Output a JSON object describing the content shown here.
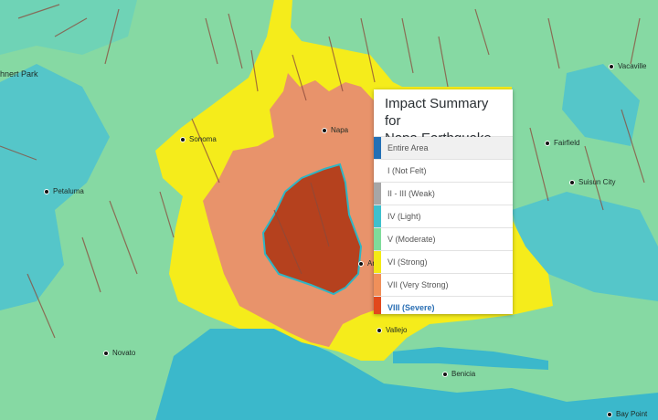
{
  "map": {
    "colors": {
      "light": "#4fc6cf",
      "moderate": "#86d9a3",
      "strong": "#f5ec1b",
      "very_strong": "#e8936b",
      "severe": "#b5411e",
      "water": "#3bb8cb",
      "fault": "#8b4a3b"
    },
    "cities": [
      {
        "name": "Vacaville"
      },
      {
        "name": "Napa"
      },
      {
        "name": "Sonoma"
      },
      {
        "name": "Fairfield"
      },
      {
        "name": "Suisun City"
      },
      {
        "name": "Petaluma"
      },
      {
        "name": "Vallejo"
      },
      {
        "name": "Novato"
      },
      {
        "name": "Benicia"
      },
      {
        "name": "Bay Point"
      },
      {
        "name": "hnert Park"
      },
      {
        "name": "Am"
      }
    ]
  },
  "panel": {
    "title_line1": "Impact Summary for",
    "title_line2": "Napa Earthquake",
    "items": [
      {
        "label": "Entire Area",
        "color": "#2370b5"
      },
      {
        "label": "I (Not Felt)",
        "color": "#ffffff"
      },
      {
        "label": "II - III (Weak)",
        "color": "#a6a6a6"
      },
      {
        "label": "IV (Light)",
        "color": "#3ec0cd"
      },
      {
        "label": "V (Moderate)",
        "color": "#7fdc9a"
      },
      {
        "label": "VI (Strong)",
        "color": "#f4ea15"
      },
      {
        "label": "VII (Very Strong)",
        "color": "#f0905a"
      },
      {
        "label": "VIII (Severe)",
        "color": "#e2481c"
      }
    ]
  }
}
